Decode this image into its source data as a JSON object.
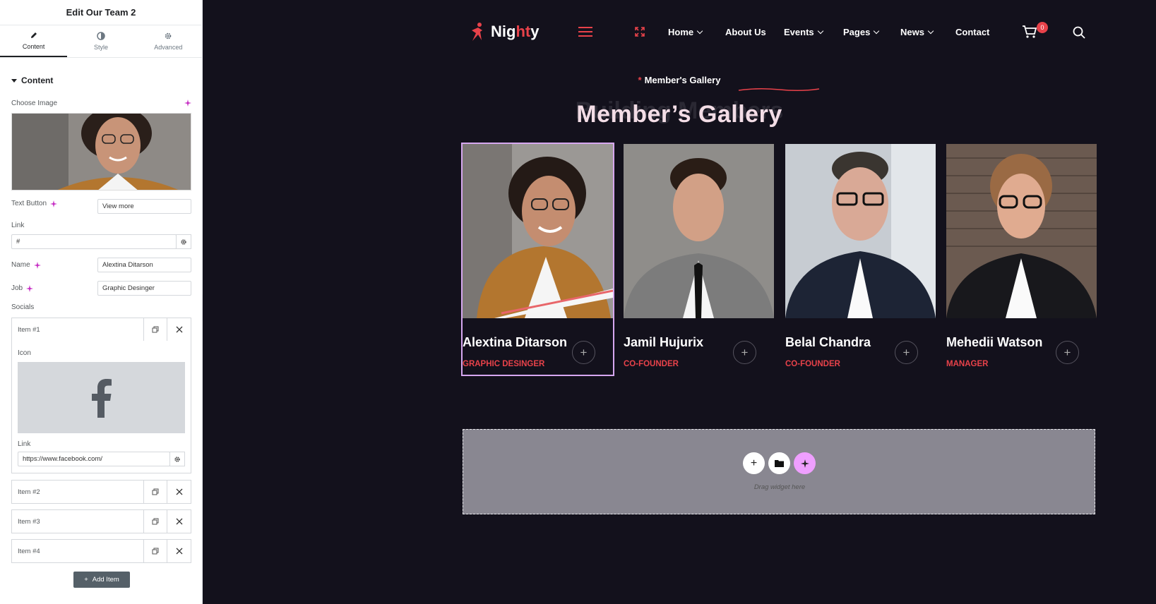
{
  "panel": {
    "title": "Edit Our Team 2",
    "tabs": [
      {
        "label": "Content",
        "icon": "pencil-icon"
      },
      {
        "label": "Style",
        "icon": "half-circle-icon"
      },
      {
        "label": "Advanced",
        "icon": "gear-icon"
      }
    ],
    "section_title": "Content",
    "choose_image_label": "Choose Image",
    "text_button_label": "Text Button",
    "text_button_value": "View more",
    "link_label": "Link",
    "link_value": "#",
    "name_label": "Name",
    "name_value": "Alextina Ditarson",
    "job_label": "Job",
    "job_value": "Graphic Desinger",
    "socials_label": "Socials",
    "items": [
      "Item #1",
      "Item #2",
      "Item #3",
      "Item #4"
    ],
    "icon_label": "Icon",
    "social_link_label": "Link",
    "social_link_value": "https://www.facebook.com/",
    "add_item_label": "Add Item"
  },
  "site": {
    "logo": {
      "pre": "Nig",
      "highlight": "ht",
      "post": "y"
    },
    "nav": [
      {
        "label": "Home",
        "dropdown": true
      },
      {
        "label": "About Us",
        "dropdown": false
      },
      {
        "label": "Events",
        "dropdown": true
      },
      {
        "label": "Pages",
        "dropdown": true
      },
      {
        "label": "News",
        "dropdown": true
      },
      {
        "label": "Contact",
        "dropdown": false
      }
    ],
    "cart_count": "0",
    "subtitle": "Member's Gallery",
    "heading": "Member’s Gallery",
    "ghost_heading": "Building Members",
    "members": [
      {
        "name": "Alextina Ditarson",
        "job": "Graphic Desinger"
      },
      {
        "name": "Jamil Hujurix",
        "job": "Co-Founder"
      },
      {
        "name": "Belal Chandra",
        "job": "Co-Founder"
      },
      {
        "name": "Mehedii Watson",
        "job": "Manager"
      }
    ],
    "drop_text": "Drag widget here"
  },
  "colors": {
    "accent": "#e8424a",
    "bg": "#13111c",
    "heading": "#f3dde6",
    "selection": "#d6a7f0"
  }
}
